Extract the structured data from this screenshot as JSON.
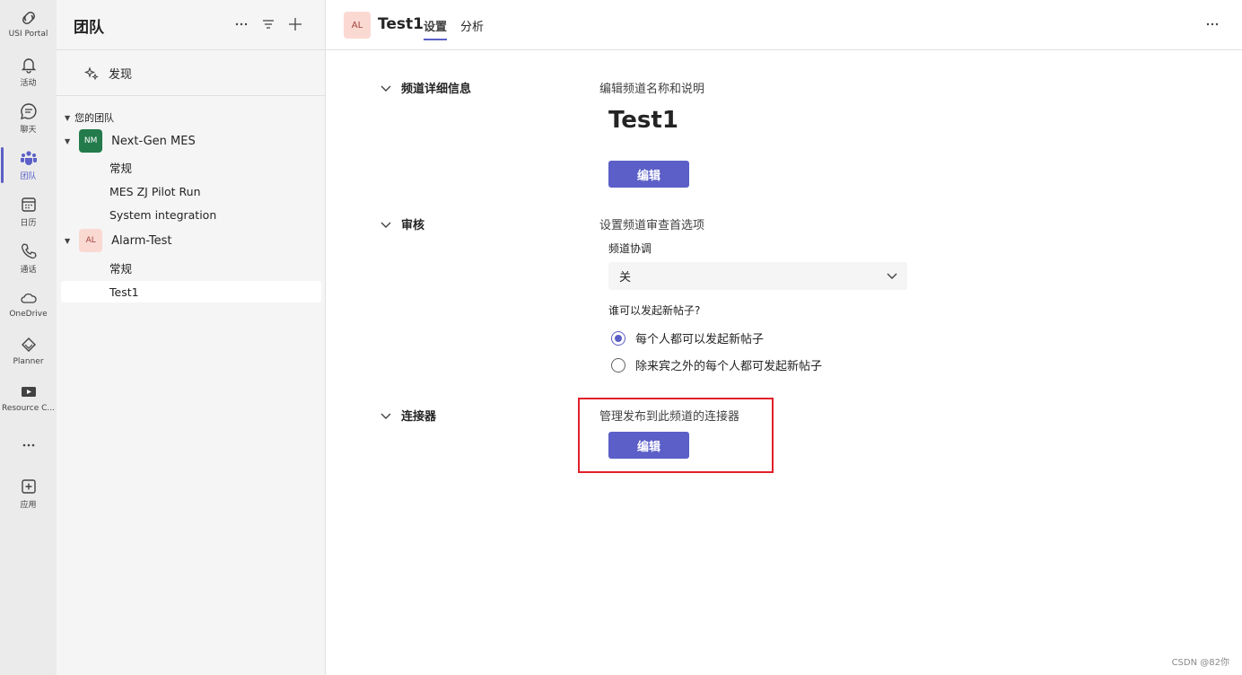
{
  "rail": {
    "items": [
      {
        "label": "USI Portal",
        "icon": "portal-icon"
      },
      {
        "label": "活动",
        "icon": "bell-icon"
      },
      {
        "label": "聊天",
        "icon": "chat-icon"
      },
      {
        "label": "团队",
        "icon": "teams-icon",
        "active": true
      },
      {
        "label": "日历",
        "icon": "calendar-icon"
      },
      {
        "label": "通话",
        "icon": "phone-icon"
      },
      {
        "label": "OneDrive",
        "icon": "cloud-icon"
      },
      {
        "label": "Planner",
        "icon": "planner-icon"
      },
      {
        "label": "Resource C...",
        "icon": "video-icon"
      },
      {
        "label": "",
        "icon": "more-icon"
      },
      {
        "label": "应用",
        "icon": "add-app-icon"
      }
    ]
  },
  "panel": {
    "title": "团队",
    "discover_label": "发现",
    "section_label": "您的团队",
    "teams": [
      {
        "name": "Next-Gen MES",
        "initials": "NM",
        "channels": [
          "常规",
          "MES ZJ Pilot Run",
          "System integration"
        ]
      },
      {
        "name": "Alarm-Test",
        "initials": "AL",
        "channels": [
          "常规",
          "Test1"
        ]
      }
    ]
  },
  "main": {
    "avatar_initials": "AL",
    "channel_title": "Test1",
    "tabs": [
      "设置",
      "分析"
    ],
    "sections": {
      "details": {
        "toggle_label": "频道详细信息",
        "description": "编辑频道名称和说明",
        "channel_name": "Test1",
        "edit_label": "编辑"
      },
      "moderation": {
        "toggle_label": "审核",
        "description": "设置频道审查首选项",
        "moderation_label": "频道协调",
        "moderation_value": "关",
        "who_can_post_label": "谁可以发起新帖子?",
        "options": [
          "每个人都可以发起新帖子",
          "除来宾之外的每个人都可发起新帖子"
        ],
        "selected_option": 0
      },
      "connectors": {
        "toggle_label": "连接器",
        "description": "管理发布到此频道的连接器",
        "edit_label": "编辑"
      }
    }
  },
  "watermark": "CSDN @82你",
  "colors": {
    "accent": "#5b5fc7",
    "highlight": "#e0202a"
  }
}
